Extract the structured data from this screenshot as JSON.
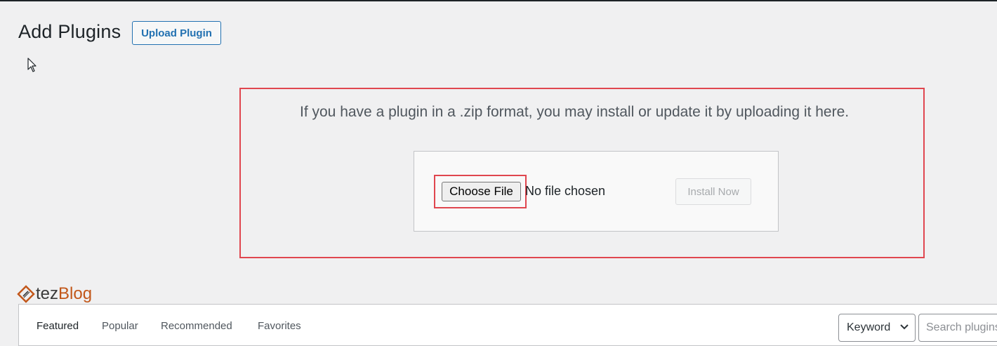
{
  "header": {
    "title": "Add Plugins",
    "upload_button_label": "Upload Plugin"
  },
  "upload": {
    "instructions": "If you have a plugin in a .zip format, you may install or update it by uploading it here.",
    "choose_file_label": "Choose File",
    "file_status": "No file chosen",
    "install_button_label": "Install Now"
  },
  "watermark": {
    "text_part1": "tez",
    "text_part2": "Blog"
  },
  "filter": {
    "tabs": [
      {
        "label": "Featured",
        "active": true
      },
      {
        "label": "Popular",
        "active": false
      },
      {
        "label": "Recommended",
        "active": false
      },
      {
        "label": "Favorites",
        "active": false
      }
    ],
    "search_type_selected": "Keyword",
    "search_placeholder": "Search plugins..."
  },
  "colors": {
    "accent": "#2271b1",
    "highlight": "#e0464f",
    "background": "#f0f0f1",
    "logo_orange": "#c2571a"
  },
  "icons": {
    "cursor": "cursor-arrow-icon",
    "logo": "tezblog-logo-icon",
    "select_chevron": "chevron-down-icon"
  }
}
